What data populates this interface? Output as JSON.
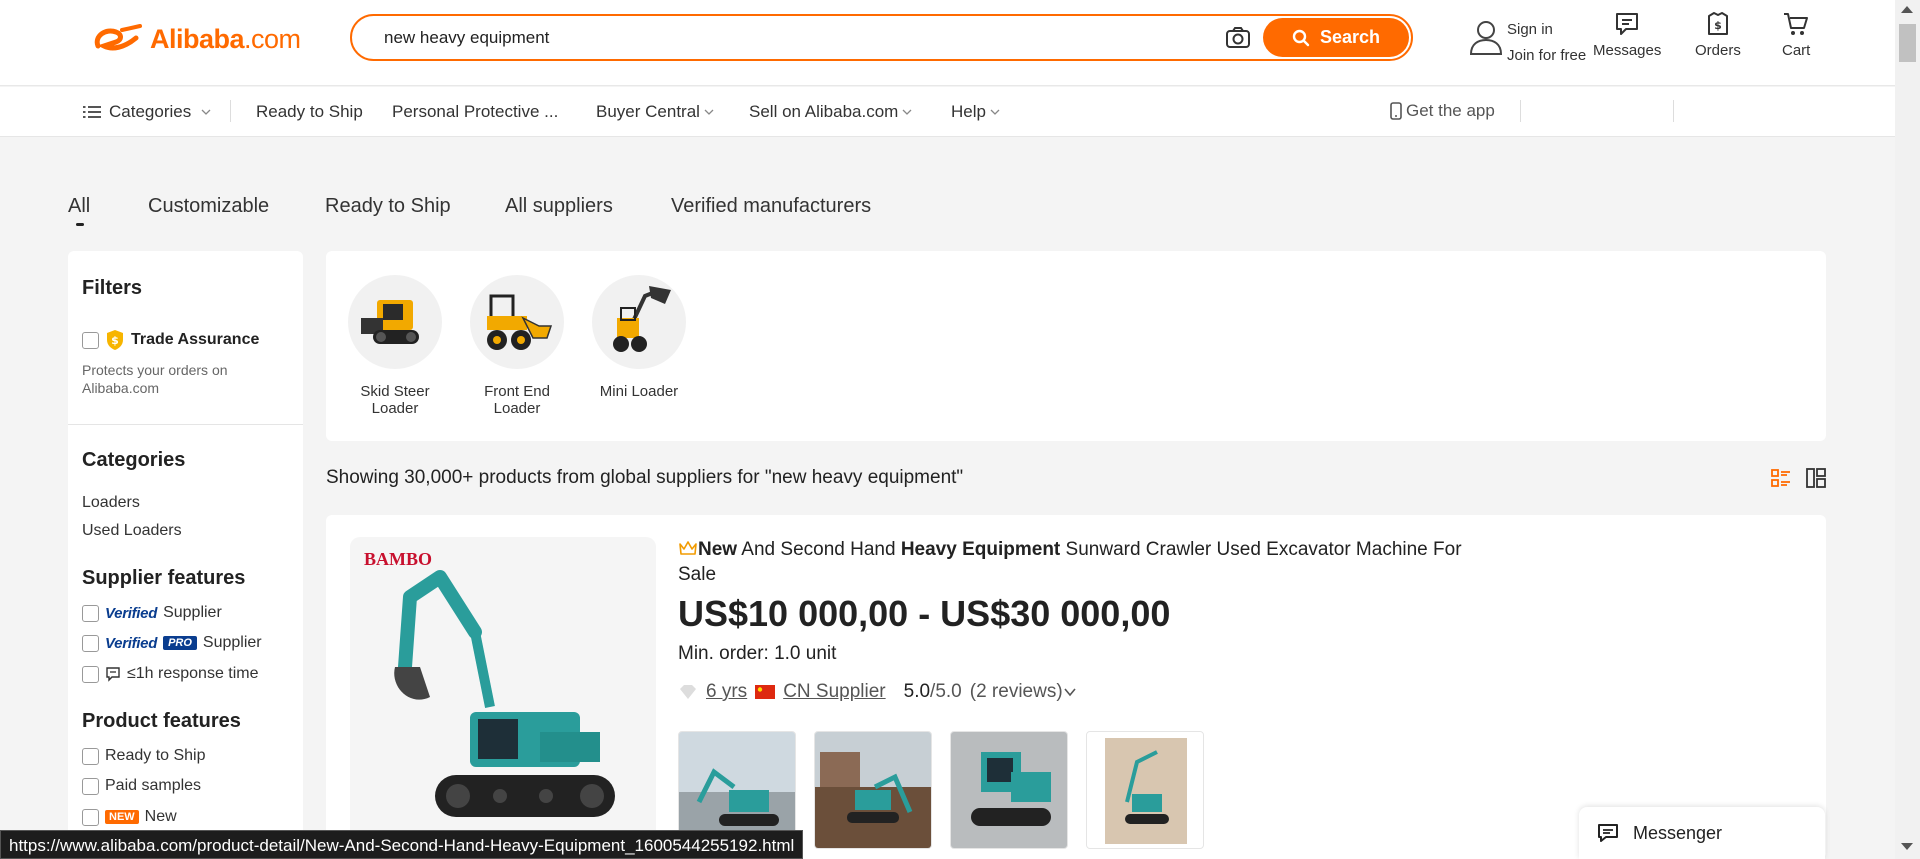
{
  "header": {
    "logo_text": "Alibaba",
    "logo_suffix": ".com",
    "search": {
      "value": "new heavy equipment",
      "button_label": "Search"
    },
    "sign_in": "Sign in",
    "join": "Join for free",
    "messages": "Messages",
    "orders": "Orders",
    "cart": "Cart"
  },
  "nav": {
    "categories": "Categories",
    "items": [
      "Ready to Ship",
      "Personal Protective ...",
      "Buyer Central",
      "Sell on Alibaba.com",
      "Help"
    ],
    "get_app": "Get the app"
  },
  "tabs": [
    "All",
    "Customizable",
    "Ready to Ship",
    "All suppliers",
    "Verified manufacturers"
  ],
  "filters": {
    "title": "Filters",
    "trade_assurance": "Trade Assurance",
    "trade_assurance_desc": "Protects your orders on Alibaba.com",
    "categories_title": "Categories",
    "categories": [
      "Loaders",
      "Used Loaders"
    ],
    "supplier_features_title": "Supplier features",
    "verified_label": "Verified",
    "pro_label": "PRO",
    "supplier_label": "Supplier",
    "response_time": "≤1h response time",
    "product_features_title": "Product features",
    "product_features": [
      "Ready to Ship",
      "Paid samples"
    ],
    "new_badge": "NEW",
    "new_label": "New"
  },
  "related_categories": [
    "Skid Steer Loader",
    "Front End Loader",
    "Mini Loader"
  ],
  "results_text": "Showing 30,000+ products from global suppliers for \"new heavy equipment\"",
  "product": {
    "brand": "BAMBO",
    "title_parts": {
      "b1": "New",
      "t1": " And Second Hand ",
      "b2": "Heavy Equipment",
      "t2": " Sunward Crawler Used Excavator Machine For Sale"
    },
    "price": "US$10 000,00 - US$30 000,00",
    "min_order": "Min. order: 1.0 unit",
    "years": "6 yrs",
    "supplier_type": "CN Supplier",
    "rating": "5.0",
    "rating_max": "/5.0",
    "reviews": "(2 reviews)"
  },
  "messenger": "Messenger",
  "status_url": "https://www.alibaba.com/product-detail/New-And-Second-Hand-Heavy-Equipment_1600544255192.html",
  "colors": {
    "accent": "#ff6a00",
    "verified_blue": "#0a3d8f",
    "brand_red": "#c8102e"
  }
}
